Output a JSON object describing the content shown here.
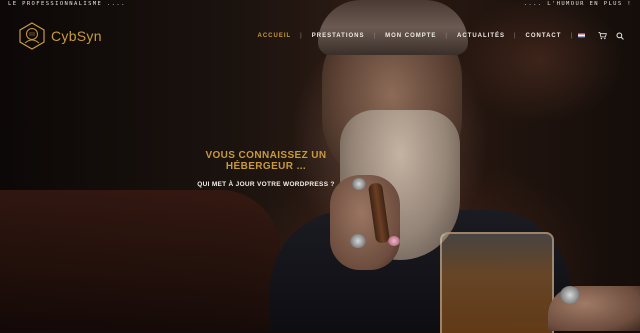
{
  "topbar": {
    "left_text": "LE PROFESSIONNALISME ....",
    "right_text": ".... L'HUMOUR EN PLUS !"
  },
  "brand": {
    "name": "CybSyn",
    "logo_icon": "hexagon-head-logo",
    "accent_color": "#c99a3b"
  },
  "nav": {
    "items": [
      {
        "label": "ACCUEIL",
        "active": true
      },
      {
        "label": "PRESTATIONS",
        "active": false
      },
      {
        "label": "MON COMPTE",
        "active": false
      },
      {
        "label": "ACTUALITÉS",
        "active": false
      },
      {
        "label": "CONTACT",
        "active": false
      }
    ],
    "language_icon": "uk-flag-icon",
    "cart_icon": "cart-icon",
    "cart_count": "0",
    "search_icon": "search-icon"
  },
  "hero": {
    "headline_line1": "VOUS CONNAISSEZ UN",
    "headline_line2": "HÉBERGEUR ...",
    "subline": "QUI MET À JOUR VOTRE WORDPRESS ?"
  }
}
